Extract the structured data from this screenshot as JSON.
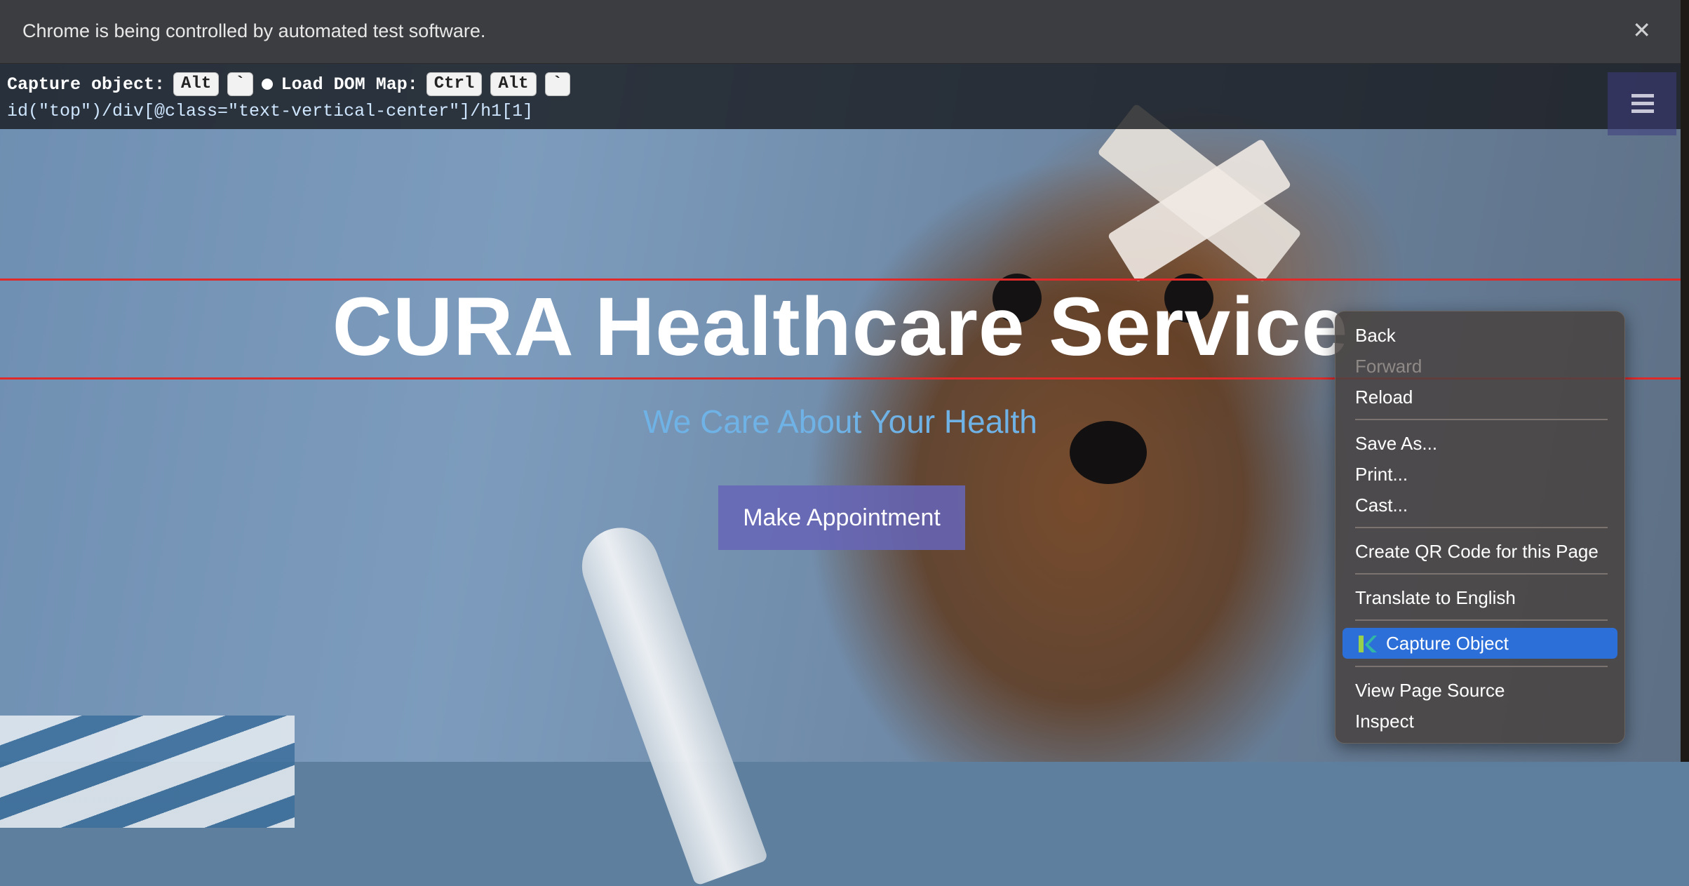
{
  "infobar": {
    "message": "Chrome is being controlled by automated test software.",
    "close_icon": "close-icon"
  },
  "capture_bar": {
    "capture_label": "Capture object:",
    "capture_keys": [
      "Alt",
      "`"
    ],
    "dom_label": "Load DOM Map:",
    "dom_keys": [
      "Ctrl",
      "Alt",
      "`"
    ],
    "xpath": "id(\"top\")/div[@class=\"text-vertical-center\"]/h1[1]"
  },
  "page": {
    "title": "CURA Healthcare Service",
    "subtitle": "We Care About Your Health",
    "appointment_button": "Make Appointment",
    "menu_icon": "hamburger-menu-icon",
    "highlight_color": "#e02a2a"
  },
  "context_menu": {
    "items": [
      {
        "label": "Back",
        "enabled": true
      },
      {
        "label": "Forward",
        "enabled": false
      },
      {
        "label": "Reload",
        "enabled": true
      },
      {
        "label": "Save As...",
        "enabled": true
      },
      {
        "label": "Print...",
        "enabled": true
      },
      {
        "label": "Cast...",
        "enabled": true
      },
      {
        "label": "Create QR Code for this Page",
        "enabled": true
      },
      {
        "label": "Translate to English",
        "enabled": true
      },
      {
        "label": "Capture Object",
        "enabled": true,
        "highlighted": true,
        "icon": "katalon-icon"
      },
      {
        "label": "View Page Source",
        "enabled": true
      },
      {
        "label": "Inspect",
        "enabled": true
      }
    ],
    "highlight_color": "#2d6fd8"
  }
}
